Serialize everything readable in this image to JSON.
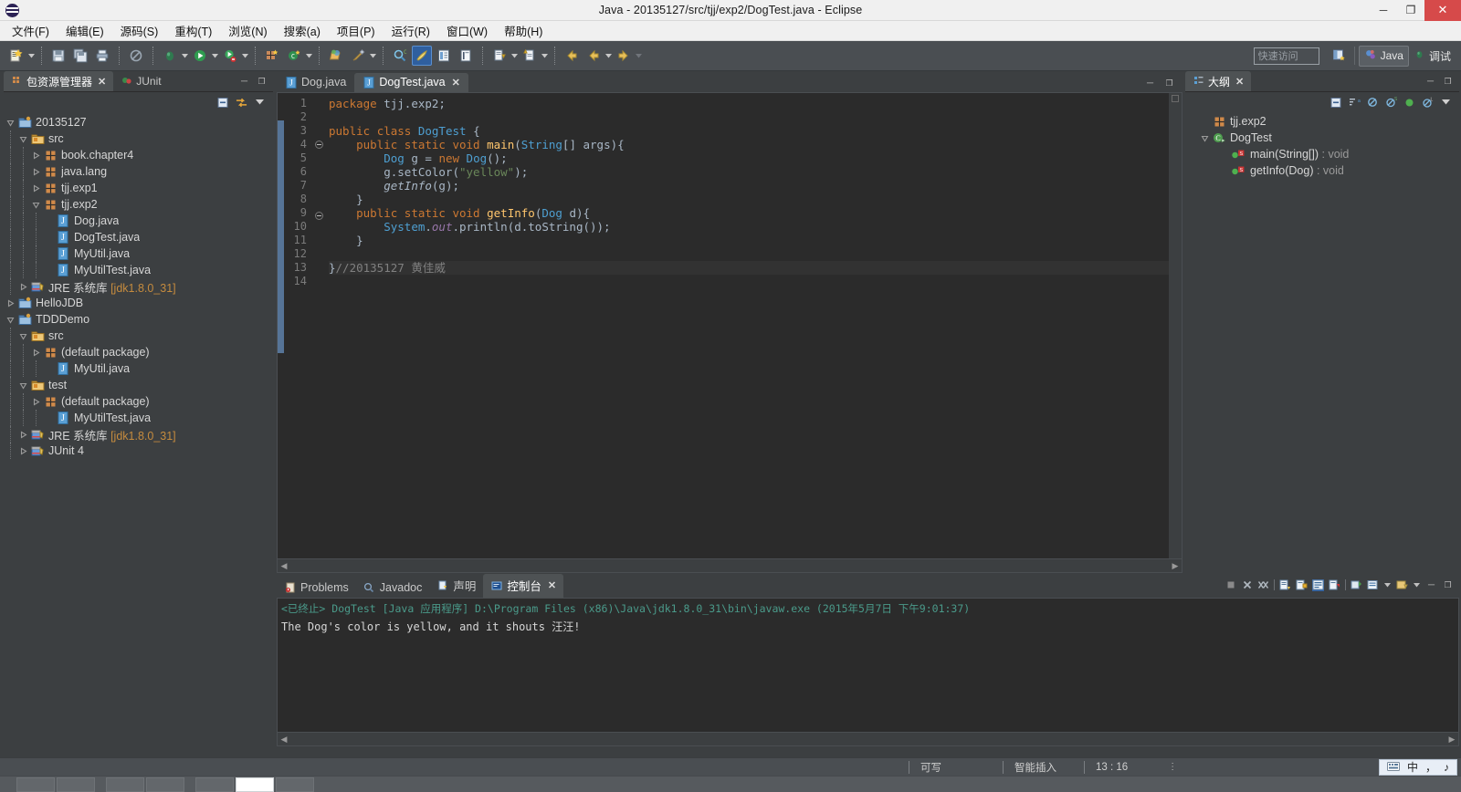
{
  "window": {
    "title": "Java - 20135127/src/tjj/exp2/DogTest.java - Eclipse",
    "minimize": "─",
    "maximize": "❐",
    "close": "✕"
  },
  "menubar": {
    "items": [
      {
        "label": "文件(F)",
        "name": "menu-file"
      },
      {
        "label": "编辑(E)",
        "name": "menu-edit"
      },
      {
        "label": "源码(S)",
        "name": "menu-source"
      },
      {
        "label": "重构(T)",
        "name": "menu-refactor"
      },
      {
        "label": "浏览(N)",
        "name": "menu-navigate"
      },
      {
        "label": "搜索(a)",
        "name": "menu-search"
      },
      {
        "label": "项目(P)",
        "name": "menu-project"
      },
      {
        "label": "运行(R)",
        "name": "menu-run"
      },
      {
        "label": "窗口(W)",
        "name": "menu-window"
      },
      {
        "label": "帮助(H)",
        "name": "menu-help"
      }
    ]
  },
  "toolbar": {
    "quick_access_placeholder": "快速访问",
    "perspective_java": "Java",
    "perspective_debug": "调试",
    "icons": [
      "new-wizard-icon",
      "save-icon",
      "save-all-icon",
      "print-icon",
      "skip-breakpoints-icon",
      "debug-icon",
      "run-icon",
      "run-last-tool-icon",
      "new-java-package-icon",
      "new-java-class-icon",
      "open-type-icon",
      "external-tools-icon",
      "search-icon",
      "toggle-markoccurrences-icon",
      "toggle-blockselection-icon",
      "show-whitespace-icon",
      "next-annotation-icon",
      "previous-annotation-icon",
      "back-icon",
      "forward-nav-icon",
      "forward-icon"
    ]
  },
  "package_explorer": {
    "tab_label": "包资源管理器",
    "tab_close": "✕",
    "second_tab_label": "JUnit",
    "view_buttons": [
      "collapse-all-icon",
      "link-with-editor-icon",
      "view-menu-icon"
    ],
    "minimize": "─",
    "maximize": "❐",
    "tree": [
      {
        "depth": 0,
        "label": "20135127",
        "icon": "java-project-icon",
        "twisty": "expanded"
      },
      {
        "depth": 1,
        "label": "src",
        "icon": "source-folder-icon",
        "twisty": "expanded"
      },
      {
        "depth": 2,
        "label": "book.chapter4",
        "icon": "package-icon",
        "twisty": "collapsed"
      },
      {
        "depth": 2,
        "label": "java.lang",
        "icon": "package-icon",
        "twisty": "collapsed"
      },
      {
        "depth": 2,
        "label": "tjj.exp1",
        "icon": "package-icon",
        "twisty": "collapsed"
      },
      {
        "depth": 2,
        "label": "tjj.exp2",
        "icon": "package-icon",
        "twisty": "expanded"
      },
      {
        "depth": 3,
        "label": "Dog.java",
        "icon": "java-file-icon",
        "twisty": "none"
      },
      {
        "depth": 3,
        "label": "DogTest.java",
        "icon": "java-file-icon",
        "twisty": "none"
      },
      {
        "depth": 3,
        "label": "MyUtil.java",
        "icon": "java-file-icon",
        "twisty": "none"
      },
      {
        "depth": 3,
        "label": "MyUtilTest.java",
        "icon": "java-file-icon",
        "twisty": "none"
      },
      {
        "depth": 1,
        "label": "JRE 系统库",
        "sub": "[jdk1.8.0_31]",
        "icon": "library-icon",
        "twisty": "collapsed"
      },
      {
        "depth": 0,
        "label": "HelloJDB",
        "icon": "java-project-icon",
        "twisty": "collapsed"
      },
      {
        "depth": 0,
        "label": "TDDDemo",
        "icon": "java-project-icon",
        "twisty": "expanded"
      },
      {
        "depth": 1,
        "label": "src",
        "icon": "source-folder-icon",
        "twisty": "expanded"
      },
      {
        "depth": 2,
        "label": "(default package)",
        "icon": "package-icon",
        "twisty": "collapsed"
      },
      {
        "depth": 3,
        "label": "MyUtil.java",
        "icon": "java-file-icon",
        "twisty": "none"
      },
      {
        "depth": 1,
        "label": "test",
        "icon": "source-folder-icon",
        "twisty": "expanded"
      },
      {
        "depth": 2,
        "label": "(default package)",
        "icon": "package-icon",
        "twisty": "collapsed"
      },
      {
        "depth": 3,
        "label": "MyUtilTest.java",
        "icon": "java-file-icon",
        "twisty": "none"
      },
      {
        "depth": 1,
        "label": "JRE 系统库",
        "sub": "[jdk1.8.0_31]",
        "icon": "library-icon",
        "twisty": "collapsed"
      },
      {
        "depth": 1,
        "label": "JUnit 4",
        "icon": "library-icon",
        "twisty": "collapsed"
      }
    ]
  },
  "editor": {
    "tabs": [
      {
        "label": "Dog.java",
        "active": false,
        "closable": false
      },
      {
        "label": "DogTest.java",
        "active": true,
        "closable": true,
        "close": "✕"
      }
    ],
    "minimize": "─",
    "maximize": "❐",
    "line_numbers": [
      "1",
      "2",
      "3",
      "4",
      "5",
      "6",
      "7",
      "8",
      "9",
      "10",
      "11",
      "12",
      "13",
      "14"
    ],
    "code_lines": [
      "package tjj.exp2;",
      "",
      "public class DogTest {",
      "    public static void main(String[] args){",
      "        Dog g = new Dog();",
      "        g.setColor(\"yellow\");",
      "        getInfo(g);",
      "    }",
      "    public static void getInfo(Dog d){",
      "        System.out.println(d.toString());",
      "    }",
      "",
      "}//20135127 黄佳威",
      ""
    ],
    "current_line": 13,
    "fold_lines": [
      4,
      9
    ]
  },
  "outline": {
    "tab_label": "大纲",
    "tab_close": "✕",
    "minimize": "─",
    "maximize": "❐",
    "view_buttons": [
      "collapse-all-icon",
      "sort-icon",
      "hide-fields-icon",
      "hide-static-icon",
      "hide-nonpublic-icon",
      "hide-local-types-icon",
      "view-menu-icon"
    ],
    "items": [
      {
        "depth": 0,
        "label": "tjj.exp2",
        "icon": "package-icon",
        "twisty": "none",
        "ret": ""
      },
      {
        "depth": 0,
        "label": "DogTest",
        "icon": "class-icon",
        "twisty": "expanded",
        "ret": ""
      },
      {
        "depth": 1,
        "label": "main(String[])",
        "icon": "public-method-icon",
        "twisty": "none",
        "ret": " : void"
      },
      {
        "depth": 1,
        "label": "getInfo(Dog)",
        "icon": "public-method-icon",
        "twisty": "none",
        "ret": " : void"
      }
    ]
  },
  "console": {
    "tabs": [
      {
        "label": "Problems",
        "active": false,
        "icon": "problems-icon"
      },
      {
        "label": "Javadoc",
        "active": false,
        "icon": "javadoc-icon"
      },
      {
        "label": "声明",
        "active": false,
        "icon": "declaration-icon"
      },
      {
        "label": "控制台",
        "active": true,
        "icon": "console-icon",
        "close": "✕"
      }
    ],
    "toolbar_icons": [
      "terminate-icon",
      "remove-launch-icon",
      "remove-all-terminated-icon",
      "clear-console-icon",
      "scroll-lock-icon",
      "word-wrap-icon",
      "pin-console-icon",
      "display-selected-console-icon",
      "open-console-icon",
      "console-dropdown-icon",
      "minimize-icon",
      "maximize-icon"
    ],
    "minimize": "─",
    "maximize": "❐",
    "launch_status": "<已终止> DogTest [Java 应用程序] D:\\Program Files (x86)\\Java\\jdk1.8.0_31\\bin\\javaw.exe (2015年5月7日 下午9:01:37)",
    "output": "The Dog's color is yellow, and it shouts 汪汪!"
  },
  "statusbar": {
    "writable": "可写",
    "insert_mode": "智能插入",
    "cursor_position": "13 : 16",
    "more": "⋮",
    "ime_lang": "中",
    "ime_punct": "，",
    "ime_extra": "♪"
  }
}
